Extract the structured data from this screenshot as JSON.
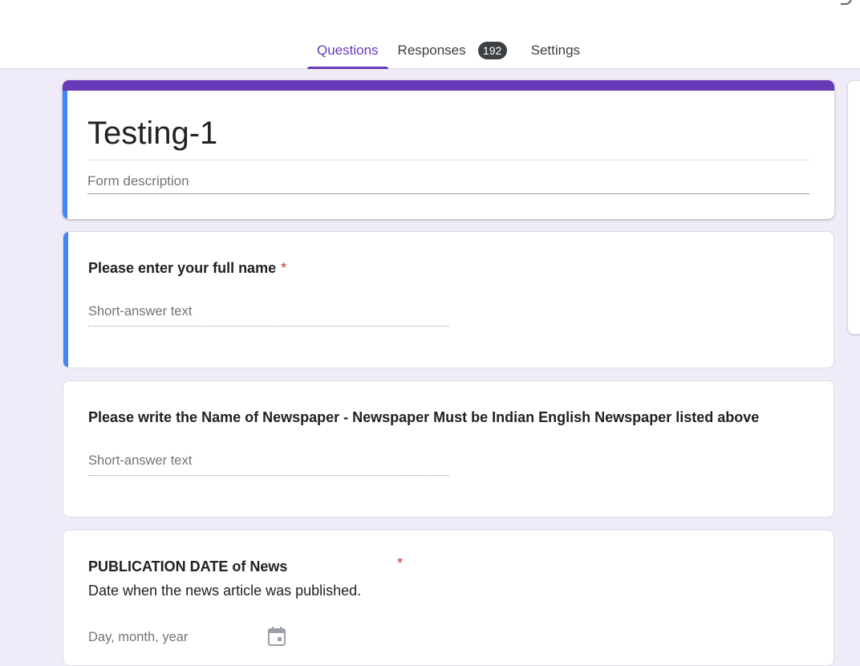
{
  "tabs": {
    "questions": "Questions",
    "responses": "Responses",
    "responses_count": "192",
    "settings": "Settings"
  },
  "form": {
    "title": "Testing-1",
    "description_placeholder": "Form description"
  },
  "questions": [
    {
      "title": "Please enter your full name",
      "required_mark": "*",
      "answer_placeholder": "Short-answer text"
    },
    {
      "title": "Please write the Name of Newspaper - Newspaper Must be Indian English Newspaper listed above",
      "answer_placeholder": "Short-answer text"
    },
    {
      "title": "PUBLICATION DATE of News",
      "required_mark": "*",
      "description": "Date when the news article  was published.",
      "answer_placeholder": "Day, month, year"
    }
  ],
  "colors": {
    "accent": "#673ab7",
    "focus": "#4285f4",
    "required": "#d93025",
    "background": "#f0ebf8"
  },
  "icons": {
    "date_picker": "calendar-icon"
  }
}
